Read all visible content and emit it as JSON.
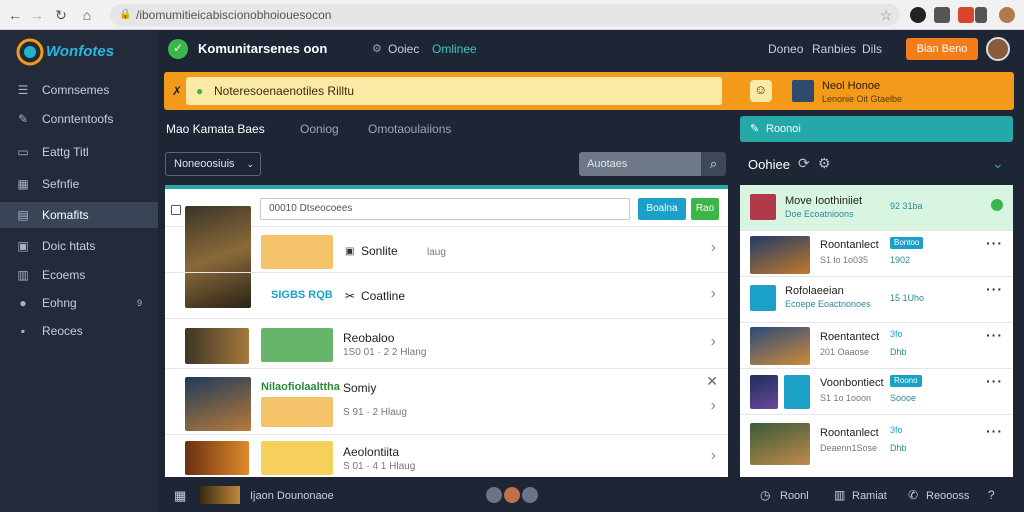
{
  "browser": {
    "url": "/ibomumitieicabiscionobhoiouesocon",
    "back_icon": "arrow-left-icon",
    "forward_icon": "arrow-right-icon",
    "reload_icon": "reload-icon",
    "home_icon": "home-icon"
  },
  "sidebar": {
    "logo_text": "Wonfotes",
    "items": [
      {
        "label": "Comnsemes",
        "icon": "menu-icon"
      },
      {
        "label": "Conntentoofs",
        "icon": "pin-icon"
      },
      {
        "label": "Eattg Titl",
        "icon": "edit-icon"
      },
      {
        "label": "Sefnfie",
        "icon": "grid-icon"
      },
      {
        "label": "Komafits",
        "icon": "folder-icon"
      },
      {
        "label": "Doic htats",
        "icon": "image-icon"
      },
      {
        "label": "Ecoems",
        "icon": "box-icon"
      },
      {
        "label": "Eohng",
        "icon": "circle-icon",
        "badge": "9"
      },
      {
        "label": "Reoces",
        "icon": "square-icon"
      }
    ]
  },
  "topbar": {
    "app_title": "Komunitarsenes oon",
    "tab1": "Ooiec",
    "tab2": "Omlinee",
    "link1": "Doneo",
    "link2": "Ranbies",
    "link3": "Dils",
    "action_button": "Bian Beno"
  },
  "banner": {
    "message": "Noteresoenaenotiles Rilltu",
    "user_name": "Neol Honoe",
    "user_sub": "Lenonie Oit Gtaelbe"
  },
  "section": {
    "title": "Mao Kamata Baes",
    "tab1": "Ooniog",
    "tab2": "Omotaoulaiions",
    "filter_label": "Noneoosiuis",
    "search_placeholder": "Auotaes"
  },
  "main_list": {
    "input_value": "00010 Dtseocoees",
    "btn1": "Boalna",
    "btn2": "Rao",
    "rows": [
      {
        "title": "Sonlite",
        "sub": "laug"
      },
      {
        "title": "Coatline",
        "label": "SIGBS RQB"
      },
      {
        "title": "Reobaloo",
        "sub": "1S0 01 · 2 2 Hlang"
      },
      {
        "title": "Somiy",
        "heading": "Nilaofiolaalttha",
        "sub": "S 91 · 2 Hlaug"
      },
      {
        "title": "Aeolontiita",
        "sub": "S 01 · 4 1 Hlaug"
      }
    ]
  },
  "right_panel": {
    "header_button": "Roonoi",
    "title": "Oohiee",
    "items": [
      {
        "title": "Move Ioothiniiet",
        "sub": "Doe Ecoatnioons",
        "meta": "92 31ba"
      },
      {
        "title": "Roontanlect",
        "sub": "S1 lo 1o035",
        "tag": "Bontoo",
        "meta": "1902"
      },
      {
        "title": "Rofolaeeian",
        "sub": "Ecoepe Eoactnonoes",
        "meta": "15 1Uho"
      },
      {
        "title": "Roentantect",
        "sub": "201 Oaaose",
        "tag": "3fo",
        "meta": "Dhb"
      },
      {
        "title": "Voonbontiect",
        "sub": "S1 1o 1ooon",
        "tag": "Roono",
        "meta": "Soooe"
      },
      {
        "title": "Roontanlect",
        "sub": "Deaenn1Sose",
        "tag": "3fo",
        "meta": "Dhb"
      }
    ]
  },
  "footer": {
    "caption": "Ijaon Dounonaoe",
    "link1": "Roonl",
    "link2": "Ramiat",
    "link3": "Reoooss"
  },
  "colors": {
    "accent_teal": "#25a9a8",
    "banner_orange": "#f39a1a",
    "sidebar": "#232b3b",
    "background": "#1e2636"
  }
}
